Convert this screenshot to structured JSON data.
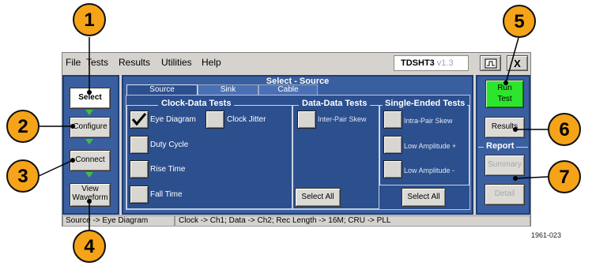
{
  "menu": [
    "File",
    "Tests",
    "Results",
    "Utilities",
    "Help"
  ],
  "app": {
    "title": "TDSHT3",
    "version": "v1.3"
  },
  "window_buttons": {
    "close": "X"
  },
  "nav": {
    "select": "Select",
    "configure": "Configure",
    "connect": "Connect",
    "view_line1": "View",
    "view_line2": "Waveform"
  },
  "panel_title": "Select - Source",
  "tabs": [
    "Source",
    "Sink",
    "Cable"
  ],
  "clock_data": {
    "title": "Clock-Data Tests",
    "eye": "Eye Diagram",
    "jitter": "Clock Jitter",
    "duty": "Duty Cycle",
    "rise": "Rise Time",
    "fall": "Fall Time"
  },
  "data_data": {
    "title": "Data-Data Tests",
    "skew": "Inter-Pair Skew",
    "select_all": "Select All"
  },
  "single_ended": {
    "title": "Single-Ended Tests",
    "skew": "Intra-Pair Skew",
    "low_plus": "Low Amplitude +",
    "low_minus": "Low Amplitude -",
    "select_all": "Select All"
  },
  "right": {
    "run_line1": "Run",
    "run_line2": "Test",
    "results": "Results",
    "report": "Report",
    "summary": "Summary",
    "detail": "Detail"
  },
  "status": {
    "left": "Source -> Eye Diagram",
    "right": "Clock -> Ch1; Data -> Ch2; Rec Length -> 16M; CRU -> PLL"
  },
  "figure_id": "1961-023",
  "callouts": [
    "1",
    "2",
    "3",
    "4",
    "5",
    "6",
    "7"
  ],
  "colors": {
    "panel_blue": "#3a5fa0",
    "run_green": "#2ee52e",
    "callout_orange": "#f5a318"
  }
}
